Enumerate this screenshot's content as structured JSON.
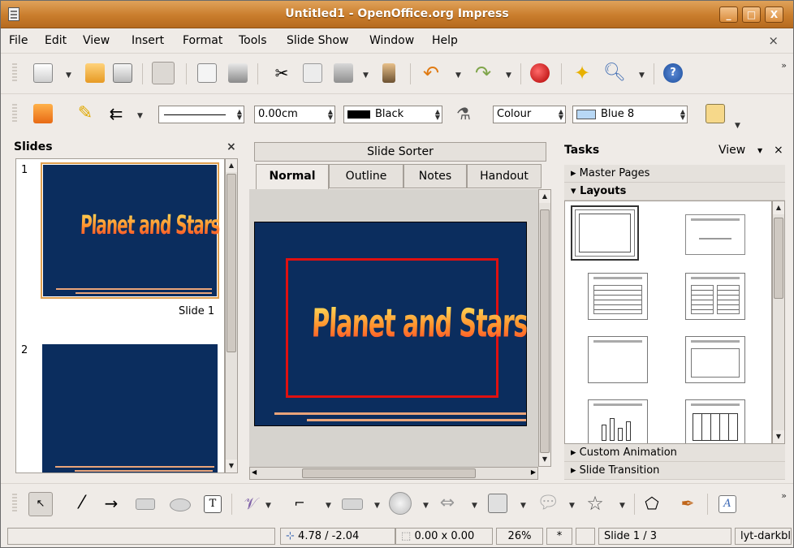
{
  "window": {
    "title": "Untitled1 - OpenOffice.org Impress",
    "buttons": [
      "_",
      "□",
      "X"
    ]
  },
  "menu": {
    "items": [
      {
        "label": "File",
        "accel": "F",
        "rest": "ile"
      },
      {
        "label": "Edit",
        "accel": "E",
        "rest": "dit"
      },
      {
        "label": "View",
        "accel": "V",
        "rest": "iew"
      },
      {
        "label": "Insert",
        "accel": "I",
        "rest": "nsert"
      },
      {
        "label": "Format",
        "accel": "",
        "rest": "Format"
      },
      {
        "label": "Tools",
        "accel": "T",
        "rest": "ools"
      },
      {
        "label": "Slide Show",
        "accel": "",
        "rest": "Slide Show"
      },
      {
        "label": "Window",
        "accel": "W",
        "rest": "indow"
      },
      {
        "label": "Help",
        "accel": "H",
        "rest": "elp"
      }
    ],
    "close_label": "×"
  },
  "line_toolbar": {
    "line_width": "0.00cm",
    "line_color": "Black",
    "area_style": "Colour",
    "area_color": "Blue 8",
    "line_color_swatch": "#000000",
    "area_color_swatch": "#b8d8f5"
  },
  "slides_pane": {
    "title": "Slides",
    "close_label": "×",
    "slides": [
      {
        "number": "1",
        "caption": "Slide 1",
        "title_art": "Planet and Stars"
      },
      {
        "number": "2",
        "caption": "",
        "title_art": ""
      }
    ]
  },
  "center": {
    "slide_sorter_label": "Slide Sorter",
    "tabs": [
      "Normal",
      "Outline",
      "Notes",
      "Handout"
    ],
    "active_tab": "Normal",
    "slide_title_art": "Planet and Stars",
    "slide_bg": "#0b2d5e",
    "frame_color": "#e01010"
  },
  "tasks": {
    "title": "Tasks",
    "view_label": "View",
    "close_label": "×",
    "sections": {
      "master_pages": "Master Pages",
      "layouts": "Layouts",
      "custom_animation": "Custom Animation",
      "slide_transition": "Slide Transition"
    }
  },
  "status": {
    "position": "4.78 / -2.04",
    "size": "0.00 x 0.00",
    "zoom": "26%",
    "modified": "*",
    "slide": "Slide 1 / 3",
    "layout": "lyt-darkblue"
  }
}
